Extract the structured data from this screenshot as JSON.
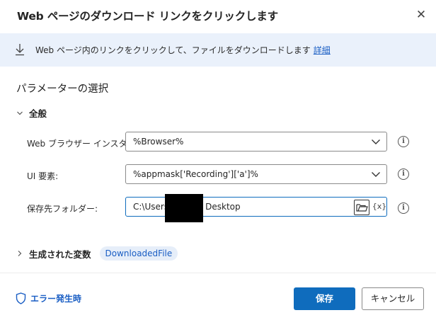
{
  "dialog": {
    "title": "Web ページのダウンロード リンクをクリックします",
    "close_glyph": "✕"
  },
  "banner": {
    "description": "Web ページ内のリンクをクリックして、ファイルをダウンロードします",
    "link": "詳細"
  },
  "section_title": "パラメーターの選択",
  "group": {
    "label": "全般",
    "chevron": "⌵"
  },
  "fields": {
    "browser_instance": {
      "label": "Web ブラウザー インスタンス:",
      "value": "%Browser%"
    },
    "ui_element": {
      "label": "UI 要素:",
      "value": "%appmask['Recording']['a']%"
    },
    "destination_folder": {
      "label": "保存先フォルダー:",
      "value_prefix": "C:\\Users\\",
      "value_suffix": "Desktop",
      "var_button": "{x}"
    }
  },
  "info_glyph": "i",
  "generated": {
    "label": "生成された変数",
    "chevron": "›",
    "variable": "DownloadedFile"
  },
  "footer": {
    "on_error": "エラー発生時",
    "save": "保存",
    "cancel": "キャンセル"
  },
  "colors": {
    "accent": "#0f6cbd",
    "banner_bg": "#eaf1fb",
    "link": "#1a5ec4"
  }
}
